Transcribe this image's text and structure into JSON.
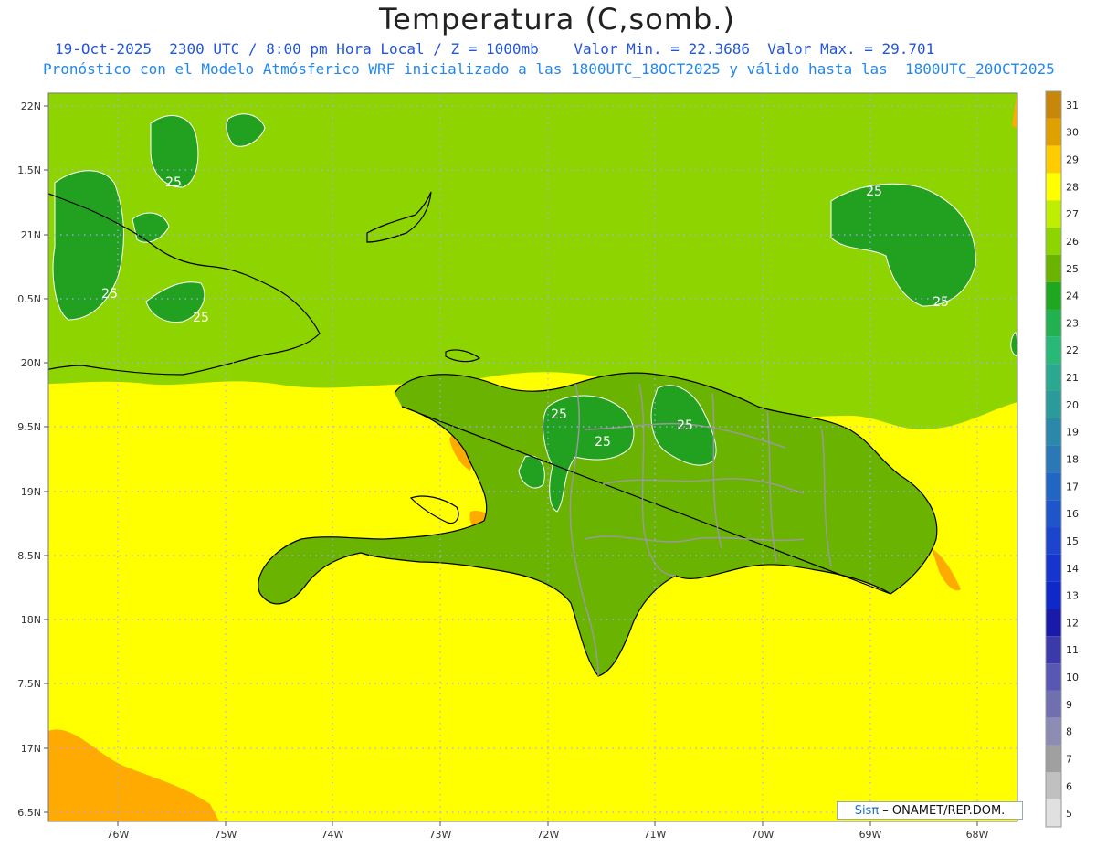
{
  "title": "Temperatura (C,somb.)",
  "subtitle_line1": "19-Oct-2025  2300 UTC / 8:00 pm Hora Local / Z = 1000mb    Valor Min. = 22.3686  Valor Max. = 29.701",
  "subtitle_line2": "Pronóstico con el Modelo Atmósferico WRF inicializado a las 1800UTC_18OCT2025 y válido hasta las  1800UTC_20OCT2025",
  "map": {
    "lat_labels": [
      "22N",
      "1.5N",
      "21N",
      "0.5N",
      "20N",
      "9.5N",
      "19N",
      "8.5N",
      "18N",
      "7.5N",
      "17N",
      "6.5N"
    ],
    "lon_labels": [
      "76W",
      "75W",
      "74W",
      "73W",
      "72W",
      "71W",
      "70W",
      "69W",
      "68W"
    ],
    "contour_labels": [
      "25",
      "25",
      "25",
      "25",
      "25",
      "25",
      "25",
      "25"
    ],
    "colors": {
      "ocean_south": "#ffff00",
      "ocean_north": "#8dd400",
      "land": "#6ab300",
      "warm": "#ffaa00",
      "cool": "#22a020",
      "coast": "#000000",
      "province": "#999999",
      "grid": "#aaaaff"
    }
  },
  "colorbar": {
    "levels": [
      "31",
      "30",
      "29",
      "28",
      "27",
      "26",
      "25",
      "24",
      "23",
      "22",
      "21",
      "20",
      "19",
      "18",
      "17",
      "16",
      "15",
      "14",
      "13",
      "12",
      "11",
      "10",
      "9",
      "8",
      "7",
      "6",
      "5"
    ],
    "colors": [
      "#c8860a",
      "#e0a000",
      "#ffcc00",
      "#ffff00",
      "#c0ee00",
      "#8dd400",
      "#6ab300",
      "#1fa81f",
      "#22b050",
      "#28b878",
      "#2aa890",
      "#2a9a9a",
      "#2a88a8",
      "#2a78b8",
      "#2266c4",
      "#1e55c8",
      "#1a45cc",
      "#1535cc",
      "#1028c8",
      "#1a1aaa",
      "#3a3aaa",
      "#5858b4",
      "#7070b0",
      "#8c8cb4",
      "#a0a0a0",
      "#c0c0c0",
      "#e0e0e0"
    ]
  },
  "credit": {
    "brand": "Sisπ",
    "text": " – ONAMET/REP.DOM."
  }
}
